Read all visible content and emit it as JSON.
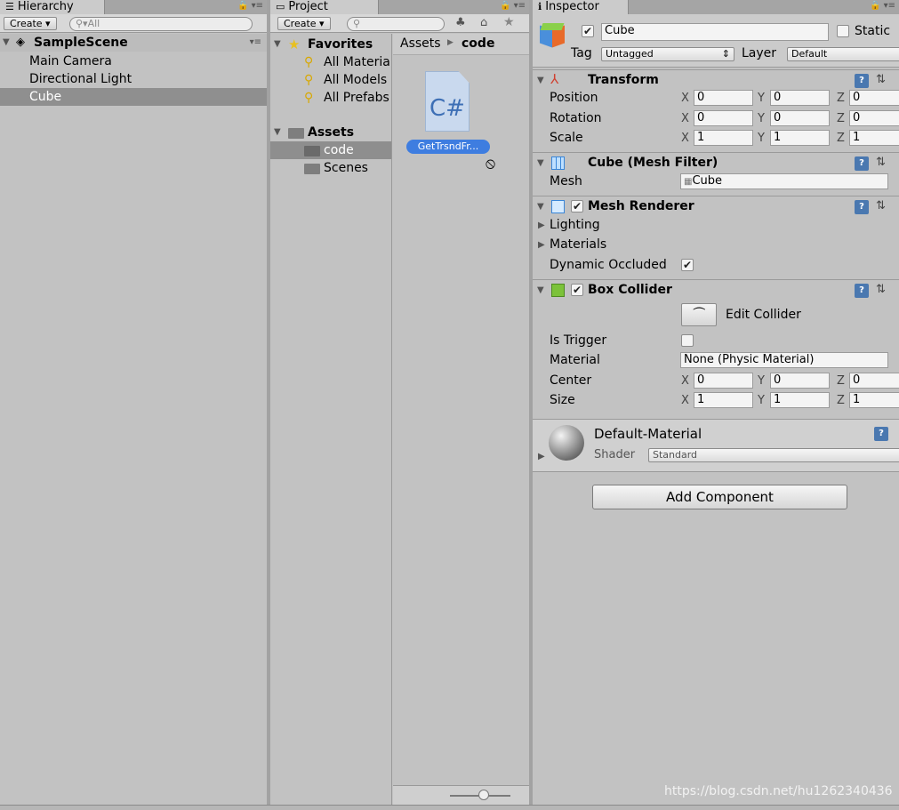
{
  "hierarchy": {
    "tab_label": "Hierarchy",
    "create_label": "Create",
    "search_placeholder": "All",
    "scene_name": "SampleScene",
    "items": [
      {
        "label": "Main Camera"
      },
      {
        "label": "Directional Light"
      },
      {
        "label": "Cube"
      }
    ]
  },
  "project": {
    "tab_label": "Project",
    "create_label": "Create",
    "favorites_label": "Favorites",
    "favorites": [
      "All Materia",
      "All Models",
      "All Prefabs"
    ],
    "assets_label": "Assets",
    "asset_folders": [
      "code",
      "Scenes"
    ],
    "breadcrumb": {
      "root": "Assets",
      "current": "code"
    },
    "file": {
      "icon_text": "C#",
      "name": "GetTrsndFr..."
    }
  },
  "inspector": {
    "tab_label": "Inspector",
    "object_name": "Cube",
    "static_label": "Static",
    "tag_label": "Tag",
    "tag_value": "Untagged",
    "layer_label": "Layer",
    "layer_value": "Default",
    "transform": {
      "title": "Transform",
      "position_label": "Position",
      "position": {
        "x": "0",
        "y": "0",
        "z": "0"
      },
      "rotation_label": "Rotation",
      "rotation": {
        "x": "0",
        "y": "0",
        "z": "0"
      },
      "scale_label": "Scale",
      "scale": {
        "x": "1",
        "y": "1",
        "z": "1"
      }
    },
    "axis": {
      "x": "X",
      "y": "Y",
      "z": "Z"
    },
    "mesh_filter": {
      "title": "Cube (Mesh Filter)",
      "mesh_label": "Mesh",
      "mesh_value": "Cube"
    },
    "mesh_renderer": {
      "title": "Mesh Renderer",
      "lighting_label": "Lighting",
      "materials_label": "Materials",
      "dynamic_occluded_label": "Dynamic Occluded"
    },
    "box_collider": {
      "title": "Box Collider",
      "edit_collider_label": "Edit Collider",
      "is_trigger_label": "Is Trigger",
      "material_label": "Material",
      "material_value": "None (Physic Material)",
      "center_label": "Center",
      "center": {
        "x": "0",
        "y": "0",
        "z": "0"
      },
      "size_label": "Size",
      "size": {
        "x": "1",
        "y": "1",
        "z": "1"
      }
    },
    "material": {
      "name": "Default-Material",
      "shader_label": "Shader",
      "shader_value": "Standard"
    },
    "add_component_label": "Add Component"
  },
  "watermark": "https://blog.csdn.net/hu1262340436"
}
